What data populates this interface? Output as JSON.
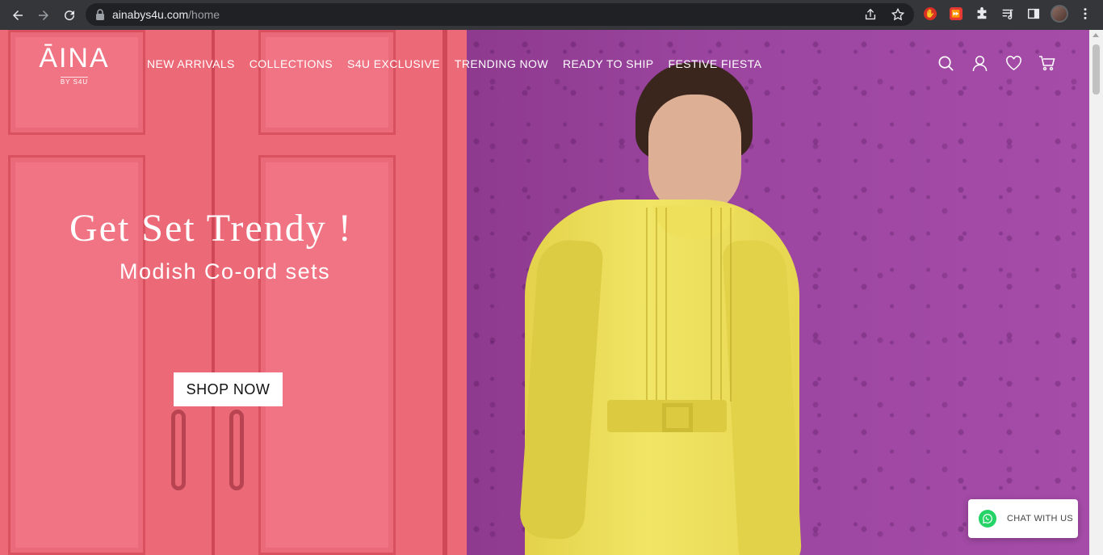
{
  "browser": {
    "url_host": "ainabys4u.com",
    "url_path": "/home",
    "icons": [
      "back-icon",
      "forward-icon",
      "reload-icon",
      "lock-icon",
      "share-icon",
      "star-icon",
      "extension-red-icon",
      "extension-icon-2",
      "puzzle-icon",
      "media-control-icon",
      "side-panel-icon",
      "profile-avatar",
      "menu-icon"
    ]
  },
  "site": {
    "logo": {
      "main": "ĀINA",
      "sub": "BY S4U"
    },
    "nav": [
      {
        "label": "NEW ARRIVALS"
      },
      {
        "label": "COLLECTIONS"
      },
      {
        "label": "S4U EXCLUSIVE"
      },
      {
        "label": "TRENDING NOW"
      },
      {
        "label": "READY TO SHIP"
      },
      {
        "label": "FESTIVE FIESTA"
      }
    ],
    "header_icons": [
      "search-icon",
      "account-icon",
      "wishlist-heart-icon",
      "cart-icon"
    ]
  },
  "hero": {
    "title": "Get Set Trendy !",
    "subtitle": "Modish Co-ord sets",
    "cta": "SHOP NOW"
  },
  "chat": {
    "label": "CHAT WITH US",
    "icon": "whatsapp-icon",
    "accent": "#25d366"
  },
  "colors": {
    "pink_wall": "#ec6a78",
    "purple_wall": "#9b45a0",
    "dress_yellow": "#efe05c"
  }
}
